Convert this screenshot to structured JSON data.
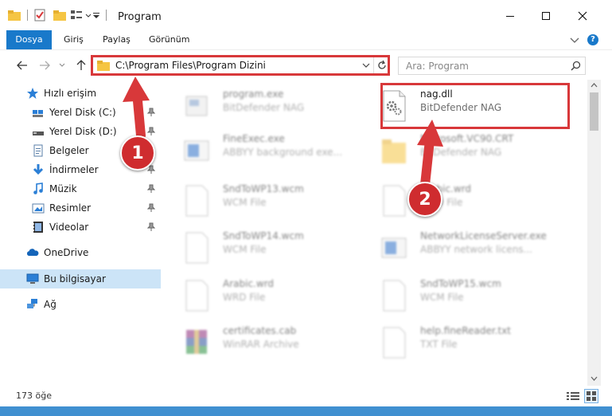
{
  "window": {
    "title": "Program"
  },
  "ribbon": {
    "tabs": [
      "Dosya",
      "Giriş",
      "Paylaş",
      "Görünüm"
    ]
  },
  "address": {
    "path": "C:\\Program Files\\Program Dizini"
  },
  "search": {
    "placeholder": "Ara: Program"
  },
  "sidebar": {
    "quick_access": "Hızlı erişim",
    "items": [
      {
        "label": "Yerel Disk (C:)",
        "icon": "drive-icon"
      },
      {
        "label": "Yerel Disk (D:)",
        "icon": "drive-icon"
      },
      {
        "label": "Belgeler",
        "icon": "documents-icon"
      },
      {
        "label": "İndirmeler",
        "icon": "download-icon"
      },
      {
        "label": "Müzik",
        "icon": "music-icon"
      },
      {
        "label": "Resimler",
        "icon": "pictures-icon"
      },
      {
        "label": "Videolar",
        "icon": "videos-icon"
      }
    ],
    "onedrive": "OneDrive",
    "this_pc": "Bu bilgisayar",
    "network": "Ağ"
  },
  "files": [
    {
      "name": "program.exe",
      "type": "BitDefender NAG"
    },
    {
      "name": "nag.dll",
      "type": "BitDefender NAG"
    },
    {
      "name": "FineExec.exe",
      "type": "ABBYY background exe..."
    },
    {
      "name": "Microsoft.VC90.CRT",
      "type": "BitDefender NAG"
    },
    {
      "name": "SndToWP13.wcm",
      "type": "WCM File"
    },
    {
      "name": "Arabic.wrd",
      "type": "WRD File"
    },
    {
      "name": "SndToWP14.wcm",
      "type": "WCM File"
    },
    {
      "name": "NetworkLicenseServer.exe",
      "type": "ABBYY network licens..."
    },
    {
      "name": "Arabic.wrd",
      "type": "WRD File"
    },
    {
      "name": "SndToWP15.wcm",
      "type": "WCM File"
    },
    {
      "name": "certificates.cab",
      "type": "WinRAR Archive"
    },
    {
      "name": "help.fineReader.txt",
      "type": "TXT File"
    }
  ],
  "status": {
    "count": "173 öğe"
  },
  "annotations": {
    "step1": "1",
    "step2": "2"
  },
  "colors": {
    "highlight": "#d8383a",
    "accent": "#1979ca",
    "selected": "#cce4f7"
  }
}
